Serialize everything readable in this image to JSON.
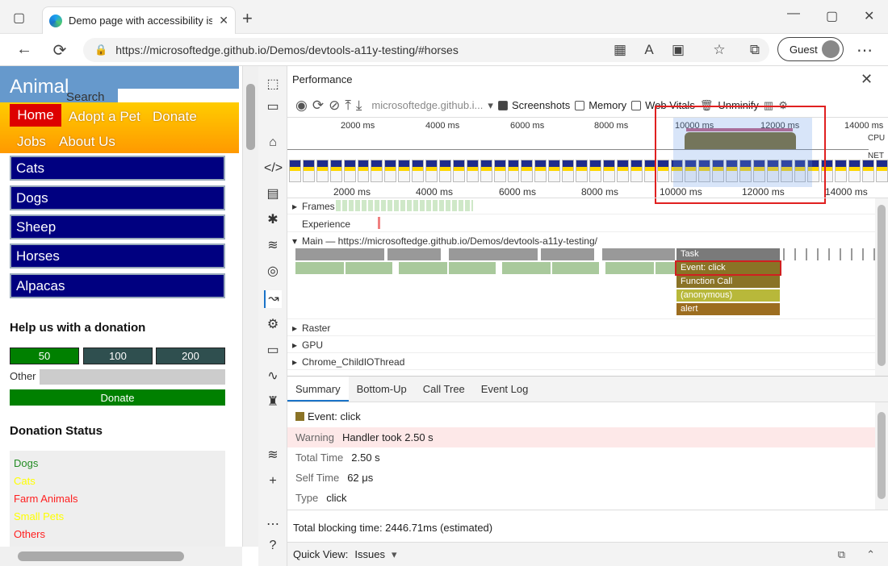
{
  "browser": {
    "tab_title": "Demo page with accessibility issu",
    "new_tab": "+",
    "url": "https://microsoftedge.github.io/Demos/devtools-a11y-testing/#horses",
    "profile": "Guest",
    "more": "⋯",
    "back": "←",
    "refresh": "⟳"
  },
  "page": {
    "logo": "Animal",
    "search": "Search",
    "nav": {
      "home": "Home",
      "adopt": "Adopt a Pet",
      "donate": "Donate",
      "jobs": "Jobs",
      "about": "About Us"
    },
    "animals": [
      "Cats",
      "Dogs",
      "Sheep",
      "Horses",
      "Alpacas"
    ],
    "donation_heading": "Help us with a donation",
    "amounts": [
      "50",
      "100",
      "200"
    ],
    "other_label": "Other",
    "donate_button": "Donate",
    "status_heading": "Donation Status",
    "status_items": [
      {
        "label": "Dogs",
        "color": "#228b22"
      },
      {
        "label": "Cats",
        "color": "#ffff00"
      },
      {
        "label": "Farm Animals",
        "color": "#ff2020"
      },
      {
        "label": "Small Pets",
        "color": "#ffff00"
      },
      {
        "label": "Others",
        "color": "#ff2020"
      }
    ]
  },
  "devtools": {
    "panel_title": "Performance",
    "toolbar": {
      "url": "microsoftedge.github.i...",
      "screenshots": "Screenshots",
      "memory": "Memory",
      "web_vitals": "Web Vitals",
      "unminify": "Unminify"
    },
    "overview_ticks": [
      "2000 ms",
      "4000 ms",
      "6000 ms",
      "8000 ms",
      "10000 ms",
      "12000 ms",
      "14000 ms"
    ],
    "ruler_ticks": [
      "2000 ms",
      "4000 ms",
      "6000 ms",
      "8000 ms",
      "10000 ms",
      "12000 ms",
      "14000 ms"
    ],
    "cpu_label": "CPU",
    "net_label": "NET",
    "tracks": {
      "frames": "Frames",
      "experience": "Experience",
      "main": "Main — https://microsoftedge.github.io/Demos/devtools-a11y-testing/",
      "raster": "Raster",
      "gpu": "GPU",
      "child": "Chrome_ChildIOThread"
    },
    "flame": [
      "Task",
      "Event: click",
      "Function Call",
      "(anonymous)",
      "alert"
    ],
    "bottom_tabs": [
      "Summary",
      "Bottom-Up",
      "Call Tree",
      "Event Log"
    ],
    "summary": {
      "title": "Event: click",
      "warning_label": "Warning",
      "warning_value": "Handler took 2.50 s",
      "total_label": "Total Time",
      "total_value": "2.50 s",
      "self_label": "Self Time",
      "self_value": "62 μs",
      "type_label": "Type",
      "type_value": "click"
    },
    "blocking": "Total blocking time: 2446.71ms (estimated)",
    "quick_view_label": "Quick View:",
    "quick_view_value": "Issues"
  }
}
